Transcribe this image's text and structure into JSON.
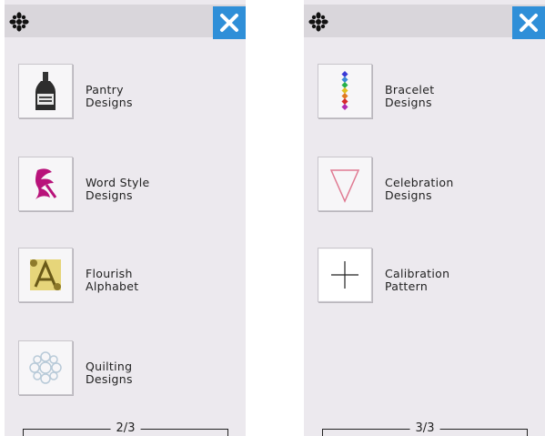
{
  "left_panel": {
    "items": [
      {
        "label": "Pantry\nDesigns",
        "icon": "bottle-icon"
      },
      {
        "label": "Word Style\nDesigns",
        "icon": "calligraphy-icon"
      },
      {
        "label": "Flourish\nAlphabet",
        "icon": "ornate-letter-icon"
      },
      {
        "label": "Quilting\nDesigns",
        "icon": "quilt-motif-icon"
      }
    ],
    "page": "2/3"
  },
  "right_panel": {
    "items": [
      {
        "label": "Bracelet\nDesigns",
        "icon": "bead-bracelet-icon"
      },
      {
        "label": "Celebration\nDesigns",
        "icon": "pennant-icon"
      },
      {
        "label": "Calibration\nPattern",
        "icon": "crosshair-icon"
      }
    ],
    "page": "3/3"
  },
  "colors": {
    "panel_bg": "#ece9ee",
    "topbar_bg": "#d9d6db",
    "close_button": "#2f8fd8"
  }
}
